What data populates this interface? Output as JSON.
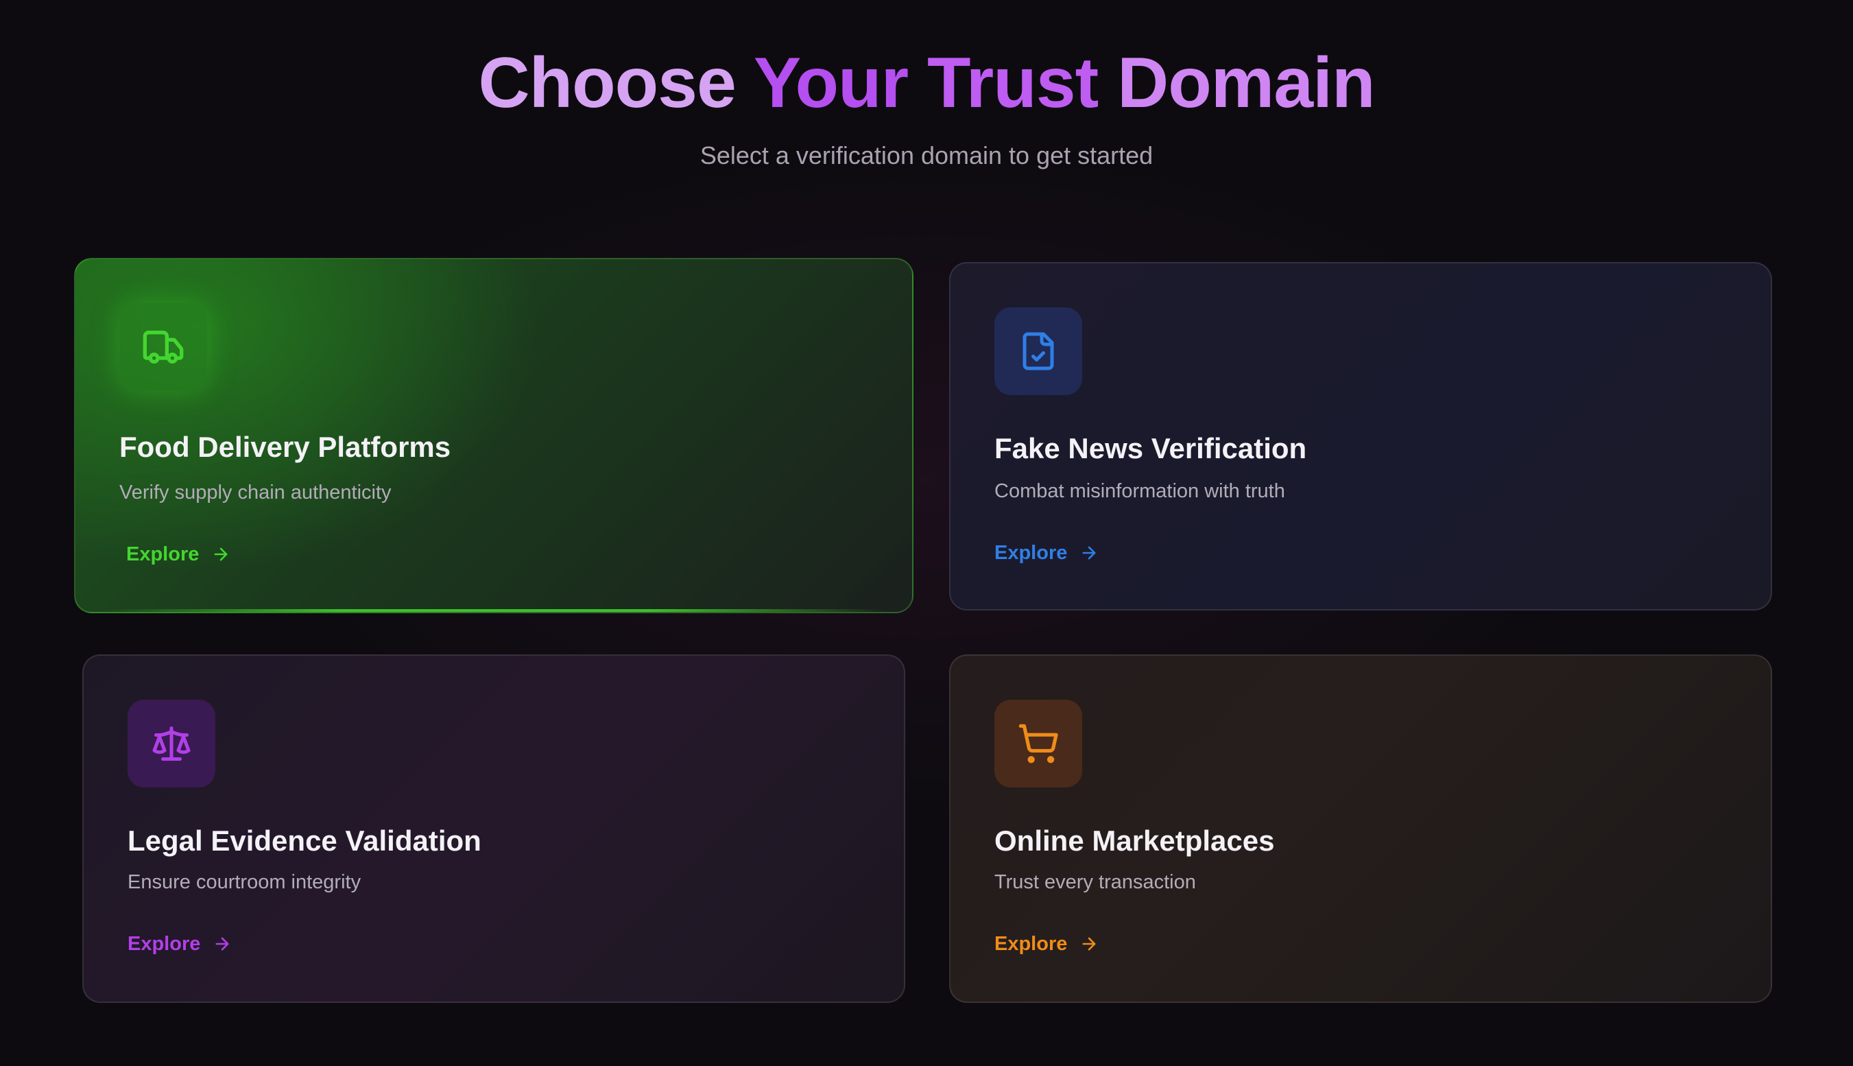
{
  "header": {
    "title_words": [
      "Choose",
      "Your",
      "Trust",
      "Domain"
    ],
    "subtitle": "Select a verification domain to get started"
  },
  "cards": [
    {
      "icon": "truck-icon",
      "title": "Food Delivery Platforms",
      "description": "Verify supply chain authenticity",
      "cta": "Explore",
      "accent": "#44d630",
      "active": true
    },
    {
      "icon": "file-check-icon",
      "title": "Fake News Verification",
      "description": "Combat misinformation with truth",
      "cta": "Explore",
      "accent": "#2f7fe6"
    },
    {
      "icon": "scale-icon",
      "title": "Legal Evidence Validation",
      "description": "Ensure courtroom integrity",
      "cta": "Explore",
      "accent": "#b23fe8"
    },
    {
      "icon": "shopping-cart-icon",
      "title": "Online Marketplaces",
      "description": "Trust every transaction",
      "cta": "Explore",
      "accent": "#f08c1a"
    }
  ]
}
